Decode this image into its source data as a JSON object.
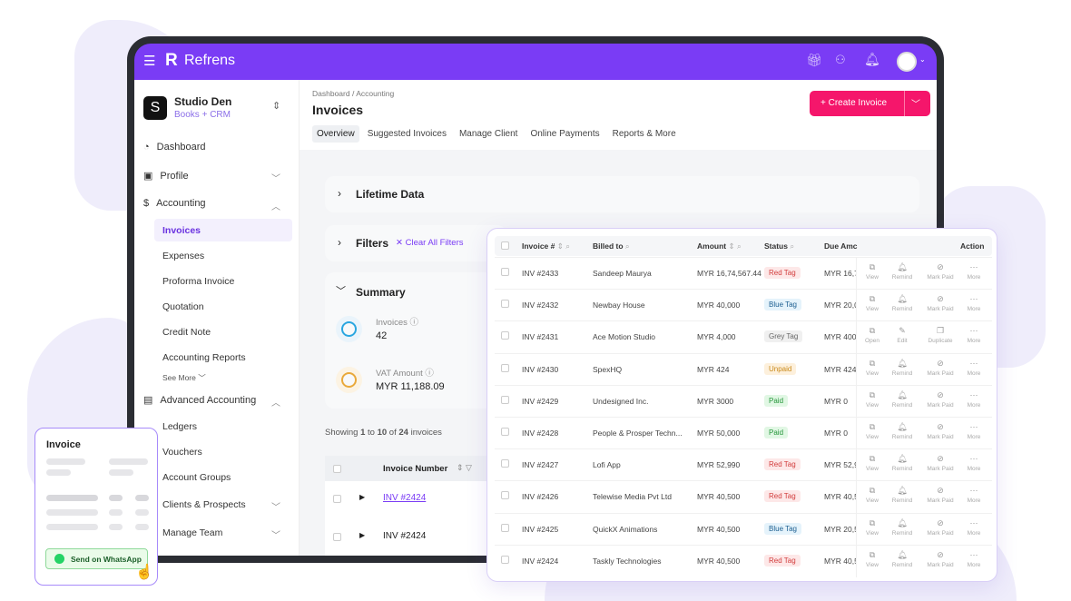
{
  "app": {
    "brand": "Refrens"
  },
  "topbar": {
    "icons": [
      "gift-icon",
      "team-icon",
      "bell-icon",
      "avatar"
    ]
  },
  "org": {
    "name": "Studio Den",
    "plan": "Books + CRM"
  },
  "sidebar": {
    "items": [
      {
        "label": "Dashboard",
        "icon": "dashboard-icon"
      },
      {
        "label": "Profile",
        "icon": "profile-icon",
        "chevron": "down"
      },
      {
        "label": "Accounting",
        "icon": "dollar-icon",
        "chevron": "up"
      }
    ],
    "accounting_sub": [
      "Invoices",
      "Expenses",
      "Proforma Invoice",
      "Quotation",
      "Credit Note",
      "Accounting Reports"
    ],
    "see_more": "See More",
    "advanced": {
      "label": "Advanced Accounting"
    },
    "advanced_sub": [
      "Ledgers",
      "Vouchers",
      "Account Groups"
    ],
    "bottom": [
      "Clients & Prospects",
      "Manage Team"
    ]
  },
  "header": {
    "breadcrumb": "Dashboard / Accounting",
    "title": "Invoices",
    "create_label": "+ Create Invoice",
    "tabs": [
      "Overview",
      "Suggested Invoices",
      "Manage Client",
      "Online Payments",
      "Reports & More"
    ],
    "active_tab": "Overview"
  },
  "sections": {
    "lifetime": "Lifetime Data",
    "filters": "Filters",
    "clear_filters": "Clear All Filters",
    "summary": "Summary"
  },
  "summary": {
    "invoices_label": "Invoices",
    "invoices_value": "42",
    "vat_label": "VAT Amount",
    "vat_value": "MYR 11,188.09"
  },
  "showing": {
    "pre": "Showing ",
    "from": "1",
    "to_word": " to ",
    "to": "10",
    "of_word": " of ",
    "total": "24",
    "post": " invoices"
  },
  "bgtable": {
    "col": "Invoice Number",
    "rows": [
      "INV #2424",
      "INV #2424"
    ]
  },
  "table": {
    "headers": [
      "Invoice #",
      "Billed to",
      "Amount",
      "Status",
      "Due Amc",
      "Action"
    ],
    "rows": [
      {
        "id": "INV #2433",
        "client": "Sandeep  Maurya",
        "amount": "MYR 16,74,567.44",
        "status": "Red Tag",
        "due": "MYR 16,7"
      },
      {
        "id": "INV #2432",
        "client": "Newbay House",
        "amount": "MYR 40,000",
        "status": "Blue Tag",
        "due": "MYR 20,0"
      },
      {
        "id": "INV #2431",
        "client": "Ace Motion Studio",
        "amount": "MYR 4,000",
        "status": "Grey Tag",
        "due": "MYR 400",
        "alt": true
      },
      {
        "id": "INV #2430",
        "client": "SpexHQ",
        "amount": "MYR  424",
        "status": "Unpaid",
        "due": "MYR  424"
      },
      {
        "id": "INV #2429",
        "client": "Undesigned Inc.",
        "amount": "MYR  3000",
        "status": "Paid",
        "due": "MYR  0"
      },
      {
        "id": "INV #2428",
        "client": "People & Prosper Techn...",
        "amount": "MYR 50,000",
        "status": "Paid",
        "due": "MYR 0"
      },
      {
        "id": "INV #2427",
        "client": "Lofi App",
        "amount": "MYR 52,990",
        "status": "Red Tag",
        "due": "MYR 52,9"
      },
      {
        "id": "INV #2426",
        "client": "Telewise Media Pvt Ltd",
        "amount": "MYR 40,500",
        "status": "Red Tag",
        "due": "MYR 40,5"
      },
      {
        "id": "INV #2425",
        "client": "QuickX Animations",
        "amount": "MYR 40,500",
        "status": "Blue Tag",
        "due": "MYR 20,5"
      },
      {
        "id": "INV #2424",
        "client": "Taskly Technologies",
        "amount": "MYR 40,500",
        "status": "Red Tag",
        "due": "MYR 40,5"
      }
    ],
    "actions": [
      "View",
      "Remind",
      "Mark Paid",
      "More"
    ],
    "actions_alt": [
      "Open",
      "Edit",
      "Duplicate",
      "More"
    ]
  },
  "tag_colors": {
    "Red Tag": [
      "#fde8e8",
      "#d23c3c"
    ],
    "Blue Tag": [
      "#e5f3fb",
      "#1d5f91"
    ],
    "Grey Tag": [
      "#f0f0f0",
      "#666666"
    ],
    "Unpaid": [
      "#fdf0dc",
      "#c98a1b"
    ],
    "Paid": [
      "#e1f7e4",
      "#25963a"
    ]
  },
  "invoice_card": {
    "title": "Invoice",
    "button": "Send on WhatsApp"
  },
  "colors": {
    "brand": "#7a3cf5",
    "accent": "#f5166b",
    "whatsapp": "#25d366"
  }
}
